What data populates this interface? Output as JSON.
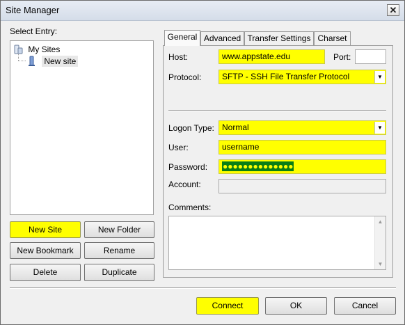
{
  "window": {
    "title": "Site Manager",
    "close_glyph": "✕"
  },
  "left": {
    "select_label": "Select Entry:",
    "tree": {
      "root_label": "My Sites",
      "child_label": "New site"
    },
    "buttons": {
      "new_site": "New Site",
      "new_folder": "New Folder",
      "new_bookmark": "New Bookmark",
      "rename": "Rename",
      "delete": "Delete",
      "duplicate": "Duplicate"
    }
  },
  "tabs": {
    "general": "General",
    "advanced": "Advanced",
    "transfer_settings": "Transfer Settings",
    "charset": "Charset"
  },
  "general": {
    "host_label": "Host:",
    "host_value": "www.appstate.edu",
    "port_label": "Port:",
    "port_value": "",
    "protocol_label": "Protocol:",
    "protocol_value": "SFTP - SSH File Transfer Protocol",
    "logon_type_label": "Logon Type:",
    "logon_type_value": "Normal",
    "user_label": "User:",
    "user_value": "username",
    "password_label": "Password:",
    "password_value": "●●●●●●●●●●●●●●",
    "account_label": "Account:",
    "account_value": "",
    "comments_label": "Comments:",
    "comments_value": ""
  },
  "footer": {
    "connect": "Connect",
    "ok": "OK",
    "cancel": "Cancel"
  },
  "colors": {
    "highlight": "#ffff00",
    "password_selection": "#0a7e15"
  }
}
